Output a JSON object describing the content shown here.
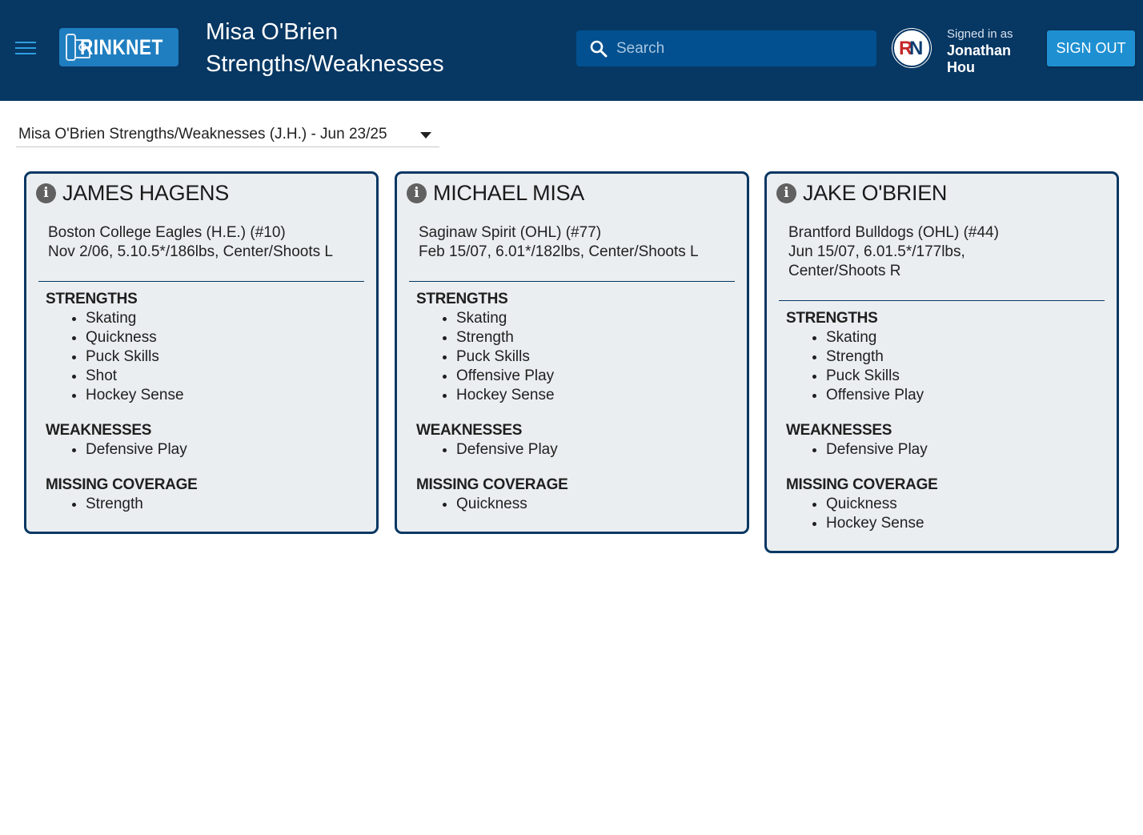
{
  "header": {
    "logo_text": "RINKNET",
    "title_line1": "Misa O'Brien",
    "title_line2": "Strengths/Weaknesses",
    "search_placeholder": "Search",
    "signed_in_label": "Signed in as",
    "user_first": "Jonathan",
    "user_last": "Hou",
    "signout_label": "SIGN OUT",
    "avatar_text": "RN"
  },
  "report_select": {
    "value": "Misa O'Brien Strengths/Weaknesses (J.H.) - Jun 23/25"
  },
  "cards": [
    {
      "name": "JAMES HAGENS",
      "info_line1": "Boston College Eagles (H.E.) (#10)",
      "info_line2": "Nov 2/06, 5.10.5*/186lbs, Center/Shoots L",
      "strengths_title": "STRENGTHS",
      "strengths": [
        "Skating",
        "Quickness",
        "Puck Skills",
        "Shot",
        "Hockey Sense"
      ],
      "weaknesses_title": "WEAKNESSES",
      "weaknesses": [
        "Defensive Play"
      ],
      "missing_title": "MISSING COVERAGE",
      "missing": [
        "Strength"
      ]
    },
    {
      "name": "MICHAEL MISA",
      "info_line1": "Saginaw Spirit (OHL) (#77)",
      "info_line2": "Feb 15/07, 6.01*/182lbs, Center/Shoots L",
      "strengths_title": "STRENGTHS",
      "strengths": [
        "Skating",
        "Strength",
        "Puck Skills",
        "Offensive Play",
        "Hockey Sense"
      ],
      "weaknesses_title": "WEAKNESSES",
      "weaknesses": [
        "Defensive Play"
      ],
      "missing_title": "MISSING COVERAGE",
      "missing": [
        "Quickness"
      ]
    },
    {
      "name": "JAKE O'BRIEN",
      "info_line1": "Brantford Bulldogs (OHL) (#44)",
      "info_line2": "Jun 15/07, 6.01.5*/177lbs,",
      "info_line3": "Center/Shoots R",
      "strengths_title": "STRENGTHS",
      "strengths": [
        "Skating",
        "Strength",
        "Puck Skills",
        "Offensive Play"
      ],
      "weaknesses_title": "WEAKNESSES",
      "weaknesses": [
        "Defensive Play"
      ],
      "missing_title": "MISSING COVERAGE",
      "missing": [
        "Quickness",
        "Hockey Sense"
      ]
    }
  ]
}
